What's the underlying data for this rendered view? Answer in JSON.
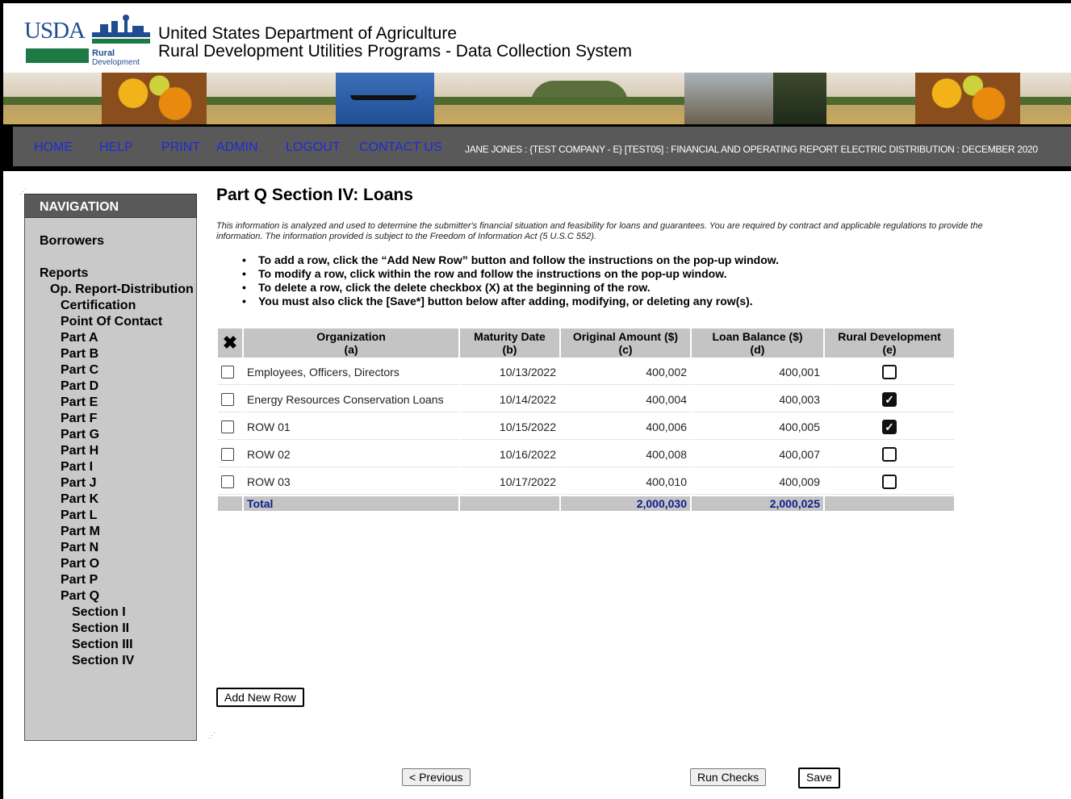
{
  "header": {
    "logo_text": "USDA",
    "logo_rural": "Rural",
    "logo_development": "Development",
    "title_line1": "United States Department of Agriculture",
    "title_line2": "Rural Development Utilities Programs - Data Collection System"
  },
  "nav": {
    "links": [
      "HOME",
      "HELP",
      "PRINT",
      "ADMIN",
      "LOGOUT",
      "CONTACT US"
    ],
    "context": "JANE JONES : {TEST COMPANY - E} [TEST05] : FINANCIAL AND OPERATING REPORT ELECTRIC DISTRIBUTION : DECEMBER 2020",
    "link_color": "#1c2bd9"
  },
  "sidebar": {
    "heading": "NAVIGATION",
    "borrowers": "Borrowers",
    "reports": "Reports",
    "report_name": "Op. Report-Distribution",
    "items": [
      "Certification",
      "Point Of Contact",
      "Part A",
      "Part B",
      "Part C",
      "Part D",
      "Part E",
      "Part F",
      "Part G",
      "Part H",
      "Part I",
      "Part J",
      "Part K",
      "Part L",
      "Part M",
      "Part N",
      "Part O",
      "Part P",
      "Part Q"
    ],
    "sections": [
      "Section I",
      "Section II",
      "Section III",
      "Section IV"
    ]
  },
  "main": {
    "title": "Part Q Section IV: Loans",
    "disclaimer_line1": "This information is analyzed and used to determine the submitter's financial situation and feasibility for loans and guarantees. You are required by contract and applicable regulations to provide the",
    "disclaimer_line2": "information. The information provided is subject to the Freedom of Information Act (5 U.S.C 552).",
    "instructions": [
      "To add a row, click the “Add New Row” button and follow the instructions on the pop-up window.",
      "To modify a row, click within the row and follow the instructions on the pop-up window.",
      "To delete a row, click the delete checkbox (X) at the beginning of the row.",
      "You must also click the [Save*] button below after adding, modifying, or deleting any row(s)."
    ]
  },
  "table": {
    "delete_header": "✖",
    "columns": [
      {
        "label": "Organization",
        "sub": "(a)"
      },
      {
        "label": "Maturity Date",
        "sub": "(b)"
      },
      {
        "label": "Original Amount ($)",
        "sub": "(c)"
      },
      {
        "label": "Loan Balance ($)",
        "sub": "(d)"
      },
      {
        "label": "Rural Development",
        "sub": "(e)"
      }
    ],
    "rows": [
      {
        "organization": "Employees, Officers, Directors",
        "maturity": "10/13/2022",
        "original": "400,002",
        "balance": "400,001",
        "rd": false
      },
      {
        "organization": "Energy Resources Conservation Loans",
        "maturity": "10/14/2022",
        "original": "400,004",
        "balance": "400,003",
        "rd": true
      },
      {
        "organization": "ROW 01",
        "maturity": "10/15/2022",
        "original": "400,006",
        "balance": "400,005",
        "rd": true
      },
      {
        "organization": "ROW 02",
        "maturity": "10/16/2022",
        "original": "400,008",
        "balance": "400,007",
        "rd": false
      },
      {
        "organization": "ROW 03",
        "maturity": "10/17/2022",
        "original": "400,010",
        "balance": "400,009",
        "rd": false
      }
    ],
    "total": {
      "label": "Total",
      "original": "2,000,030",
      "balance": "2,000,025"
    }
  },
  "buttons": {
    "add_row": "Add New Row",
    "previous": "< Previous",
    "run_checks": "Run Checks",
    "save": "Save"
  }
}
